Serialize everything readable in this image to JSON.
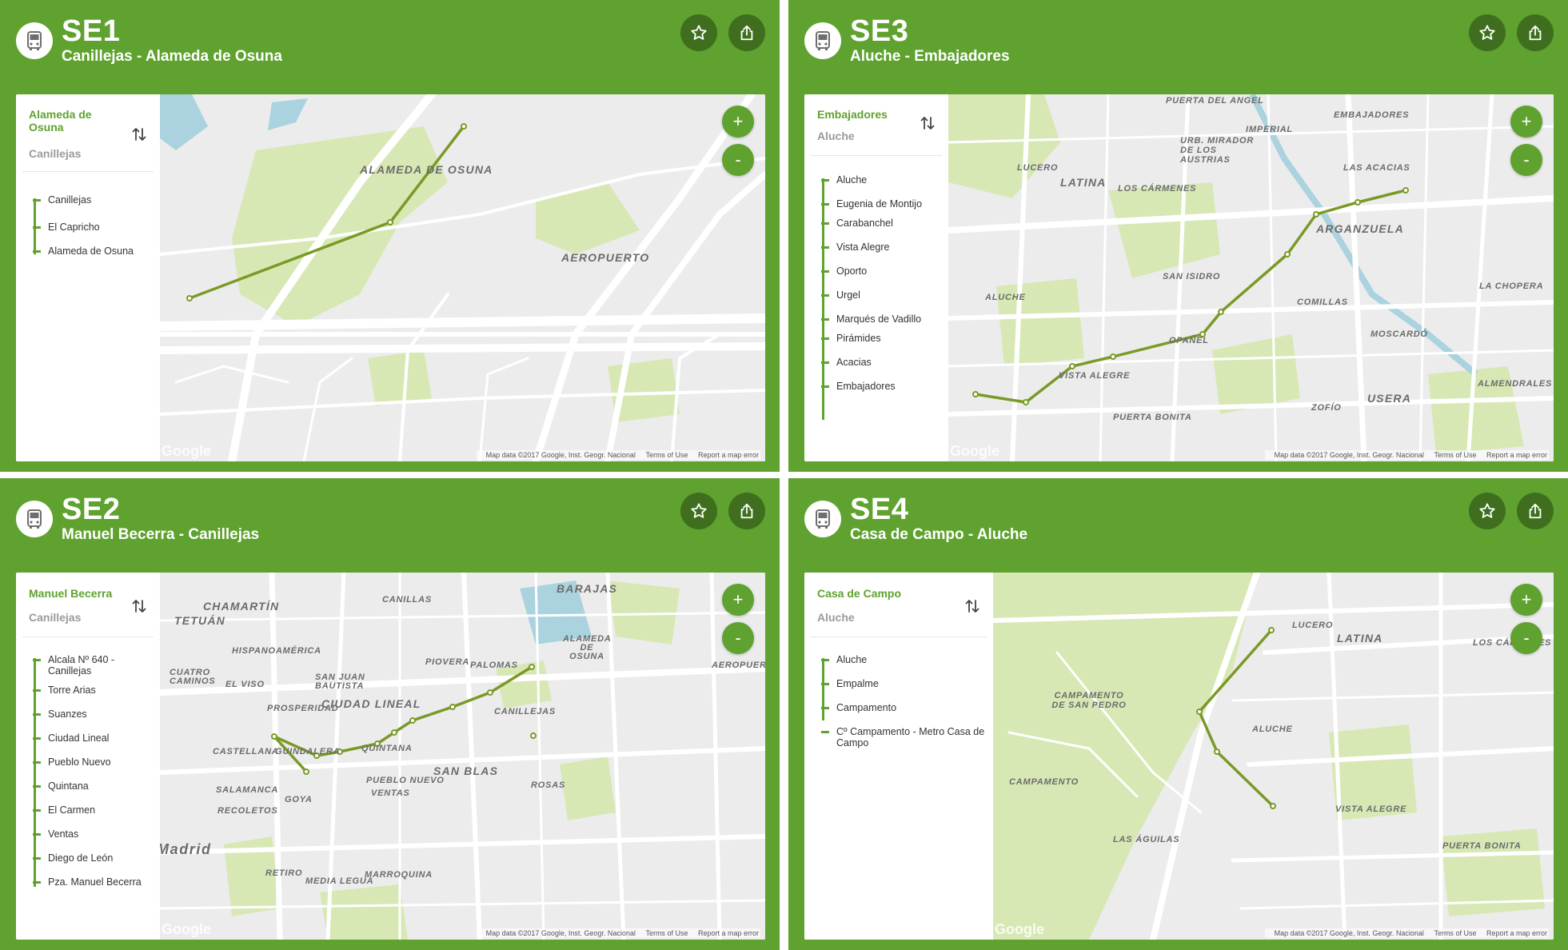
{
  "colors": {
    "brand_green": "#5fa22f",
    "dark_green_button": "#3f6f1e",
    "route_line": "#7a9a27",
    "park": "#d7e8b4",
    "road": "#ffffff",
    "water": "#aad3df"
  },
  "icons": {
    "bus": "bus-icon",
    "favorite": "star-icon",
    "share": "share-icon",
    "swap": "swap-direction-icon",
    "zoom_in": "plus-icon",
    "zoom_out": "minus-icon"
  },
  "panels": [
    {
      "code": "SE1",
      "name": "Canillejas - Alameda de Osuna",
      "from": "Alameda de Osuna",
      "to": "Canillejas",
      "stops": [
        "Canillejas",
        "El Capricho",
        "Alameda de Osuna"
      ],
      "zoom_in": "+",
      "zoom_out": "-",
      "attribution": {
        "data": "Map data ©2017 Google, Inst. Geogr. Nacional",
        "terms": "Terms of Use",
        "report": "Report a map error"
      },
      "google": "Google",
      "map_labels": [
        "ALAMEDA DE OSUNA",
        "AEROPUERTO"
      ]
    },
    {
      "code": "SE3",
      "name": "Aluche - Embajadores",
      "from": "Embajadores",
      "to": "Aluche",
      "stops": [
        "Aluche",
        "Eugenia de Montijo",
        "Carabanchel",
        "Vista Alegre",
        "Oporto",
        "Urgel",
        "Marqués de Vadillo",
        "Pirámides",
        "Acacias",
        "Embajadores"
      ],
      "zoom_in": "+",
      "zoom_out": "-",
      "attribution": {
        "data": "Map data ©2017 Google, Inst. Geogr. Nacional",
        "terms": "Terms of Use",
        "report": "Report a map error"
      },
      "google": "Google",
      "map_labels": [
        "PUERTA DEL ANGEL",
        "IMPERIAL",
        "EMBAJADORES",
        "LUCERO",
        "LATINA",
        "URB. MIRADOR DE LOS AUSTRIAS",
        "LOS CÁRMENES",
        "LAS ACACIAS",
        "ARGANZUELA",
        "SAN ISIDRO",
        "ALUCHE",
        "COMILLAS",
        "LA CHOPERA",
        "MOSCARDÓ",
        "OPAÑEL",
        "VISTA ALEGRE",
        "ALMENDRALES",
        "ZOFÍO",
        "USERA",
        "PUERTA BONITA"
      ]
    },
    {
      "code": "SE2",
      "name": "Manuel Becerra - Canillejas",
      "from": "Manuel Becerra",
      "to": "Canillejas",
      "stops": [
        "Alcala Nº 640 - Canillejas",
        "Torre Arias",
        "Suanzes",
        "Ciudad Lineal",
        "Pueblo Nuevo",
        "Quintana",
        "El Carmen",
        "Ventas",
        "Diego de León",
        "Pza. Manuel Becerra"
      ],
      "zoom_in": "+",
      "zoom_out": "-",
      "attribution": {
        "data": "Map data ©2017 Google, Inst. Geogr. Nacional",
        "terms": "Terms of Use",
        "report": "Report a map error"
      },
      "google": "Google",
      "map_labels": [
        "BARAJAS",
        "CHAMARTÍN",
        "CANILLAS",
        "TETUÁN",
        "HISPANOAMÉRICA",
        "ALAMEDA DE OSUNA",
        "PIOVERA",
        "CUATRO CAMINOS",
        "EL VISO",
        "SAN JUAN BAUTISTA",
        "PALOMAS",
        "AEROPUERTO",
        "PROSPERIDAD",
        "CIUDAD LINEAL",
        "CANILLEJAS",
        "CASTELLANA",
        "GUINDALERA",
        "QUINTANA",
        "SAN BLAS",
        "SALAMANCA",
        "PUEBLO NUEVO",
        "VENTAS",
        "ROSAS",
        "GOYA",
        "RECOLETOS",
        "Madrid",
        "RETIRO",
        "MEDIA LEGUA",
        "MARROQUINA"
      ]
    },
    {
      "code": "SE4",
      "name": "Casa de Campo - Aluche",
      "from": "Casa de Campo",
      "to": "Aluche",
      "stops": [
        "Aluche",
        "Empalme",
        "Campamento",
        "Cº Campamento - Metro Casa de Campo"
      ],
      "zoom_in": "+",
      "zoom_out": "-",
      "attribution": {
        "data": "Map data ©2017 Google, Inst. Geogr. Nacional",
        "terms": "Terms of Use",
        "report": "Report a map error"
      },
      "google": "Google",
      "map_labels": [
        "LUCERO",
        "LATINA",
        "LOS CÁRMENES",
        "CAMPAMENTO DE SAN PEDRO",
        "ALUCHE",
        "CAMPAMENTO",
        "VISTA ALEGRE",
        "LAS ÁGUILAS",
        "PUERTA BONITA"
      ]
    }
  ]
}
